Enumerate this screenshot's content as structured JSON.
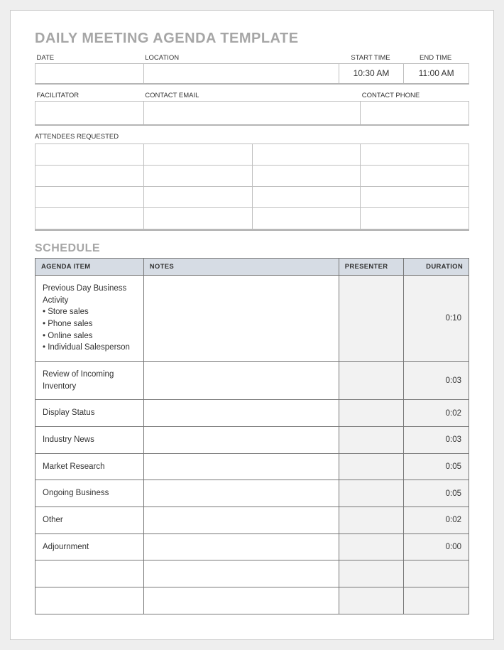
{
  "title": "DAILY MEETING AGENDA TEMPLATE",
  "info1": {
    "labels": {
      "date": "DATE",
      "location": "LOCATION",
      "start": "START TIME",
      "end": "END TIME"
    },
    "values": {
      "date": "",
      "location": "",
      "start": "10:30 AM",
      "end": "11:00 AM"
    }
  },
  "info2": {
    "labels": {
      "facilitator": "FACILITATOR",
      "email": "CONTACT EMAIL",
      "phone": "CONTACT PHONE"
    },
    "values": {
      "facilitator": "",
      "email": "",
      "phone": ""
    }
  },
  "attendees": {
    "label": "ATTENDEES REQUESTED",
    "rows": [
      [
        "",
        "",
        "",
        ""
      ],
      [
        "",
        "",
        "",
        ""
      ],
      [
        "",
        "",
        "",
        ""
      ],
      [
        "",
        "",
        "",
        ""
      ]
    ]
  },
  "schedule": {
    "heading": "SCHEDULE",
    "headers": {
      "item": "AGENDA ITEM",
      "notes": "NOTES",
      "presenter": "PRESENTER",
      "duration": "DURATION"
    },
    "rows": [
      {
        "item": "Previous Day Business Activity\n• Store sales\n• Phone sales\n• Online sales\n• Individual Salesperson",
        "notes": "",
        "presenter": "",
        "duration": "0:10"
      },
      {
        "item": "Review of Incoming Inventory",
        "notes": "",
        "presenter": "",
        "duration": "0:03"
      },
      {
        "item": "Display Status",
        "notes": "",
        "presenter": "",
        "duration": "0:02"
      },
      {
        "item": "Industry News",
        "notes": "",
        "presenter": "",
        "duration": "0:03"
      },
      {
        "item": "Market Research",
        "notes": "",
        "presenter": "",
        "duration": "0:05"
      },
      {
        "item": "Ongoing Business",
        "notes": "",
        "presenter": "",
        "duration": "0:05"
      },
      {
        "item": "Other",
        "notes": "",
        "presenter": "",
        "duration": "0:02"
      },
      {
        "item": "Adjournment",
        "notes": "",
        "presenter": "",
        "duration": "0:00"
      },
      {
        "item": "",
        "notes": "",
        "presenter": "",
        "duration": ""
      },
      {
        "item": "",
        "notes": "",
        "presenter": "",
        "duration": ""
      }
    ]
  }
}
